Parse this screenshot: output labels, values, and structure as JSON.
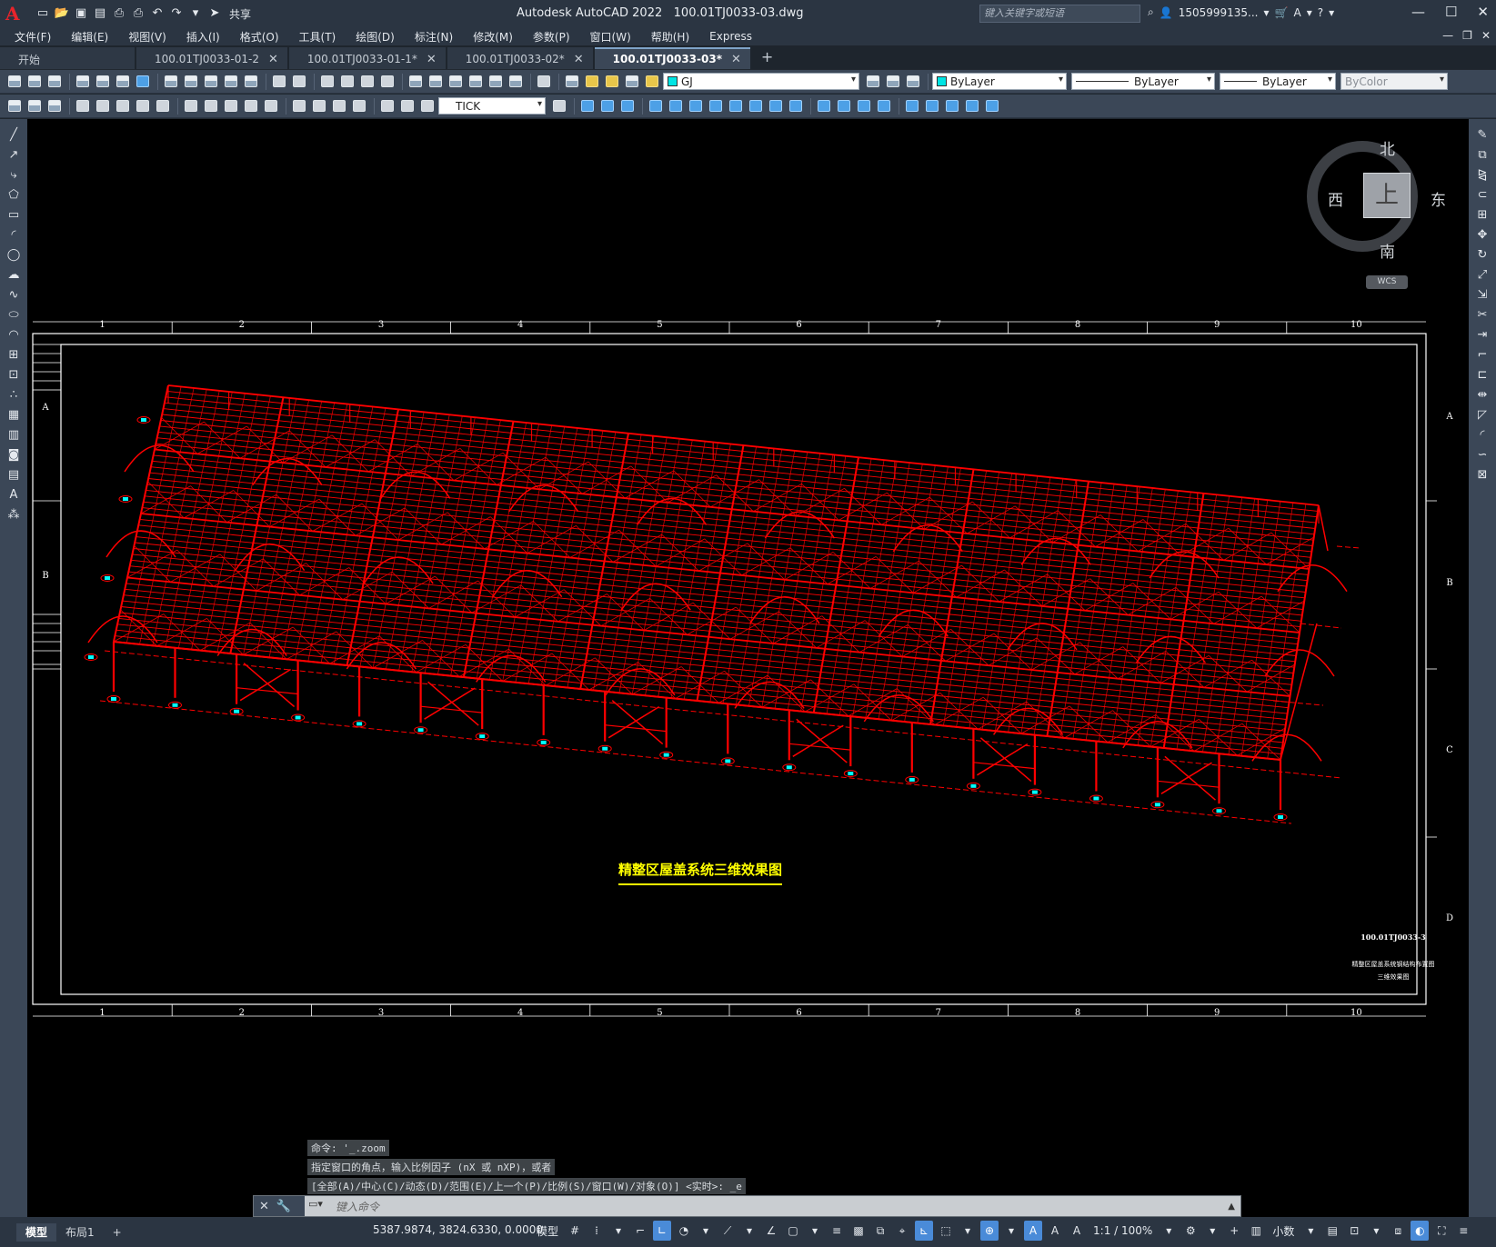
{
  "app": {
    "title": "Autodesk AutoCAD 2022",
    "filename": "100.01TJ0033-03.dwg",
    "logo": "A",
    "search_placeholder": "键入关键字或短语",
    "user": "1505999135...",
    "share_label": "共享"
  },
  "menu": [
    "文件(F)",
    "编辑(E)",
    "视图(V)",
    "插入(I)",
    "格式(O)",
    "工具(T)",
    "绘图(D)",
    "标注(N)",
    "修改(M)",
    "参数(P)",
    "窗口(W)",
    "帮助(H)",
    "Express"
  ],
  "tabs": [
    {
      "label": "开始",
      "closable": false
    },
    {
      "label": "100.01TJ0033-01-2",
      "closable": true
    },
    {
      "label": "100.01TJ0033-01-1*",
      "closable": true
    },
    {
      "label": "100.01TJ0033-02*",
      "closable": true
    },
    {
      "label": "100.01TJ0033-03*",
      "closable": true,
      "active": true
    }
  ],
  "toolbar": {
    "layer": "GJ",
    "color": "ByLayer",
    "linetype": "ByLayer",
    "lineweight": "ByLayer",
    "plotstyle": "ByColor",
    "dimstyle": "TICK"
  },
  "viewcube": {
    "north": "北",
    "south": "南",
    "east": "东",
    "west": "西",
    "top": "上",
    "wcs": "WCS"
  },
  "drawing": {
    "title": "精整区屋盖系统三维效果图",
    "drawing_number": "100.01TJ0033-3",
    "titleblock_line1": "精整区屋盖系统钢结构布置图",
    "titleblock_line2": "三维效果图",
    "grid_cols": [
      "1",
      "2",
      "3",
      "4",
      "5",
      "6",
      "7",
      "8",
      "9",
      "10"
    ],
    "grid_rows_left": [
      "A",
      "B"
    ],
    "grid_rows_right": [
      "A",
      "B",
      "C",
      "D"
    ],
    "colors": {
      "frame": "#ff0000",
      "title_text": "#ffff00",
      "title_line": "#ffff00",
      "border": "#ffffff",
      "support_marker": "#00ffff"
    }
  },
  "command": {
    "history": [
      "命令: '_.zoom",
      "指定窗口的角点，输入比例因子 (nX 或 nXP)，或者",
      "[全部(A)/中心(C)/动态(D)/范围(E)/上一个(P)/比例(S)/窗口(W)/对象(O)] <实时>: _e"
    ],
    "placeholder": "键入命令"
  },
  "status": {
    "layout_tabs": [
      "模型",
      "布局1"
    ],
    "coords": "5387.9874, 3824.6330, 0.0000",
    "model": "模型",
    "scale": "1:1 / 100%",
    "units": "小数"
  }
}
